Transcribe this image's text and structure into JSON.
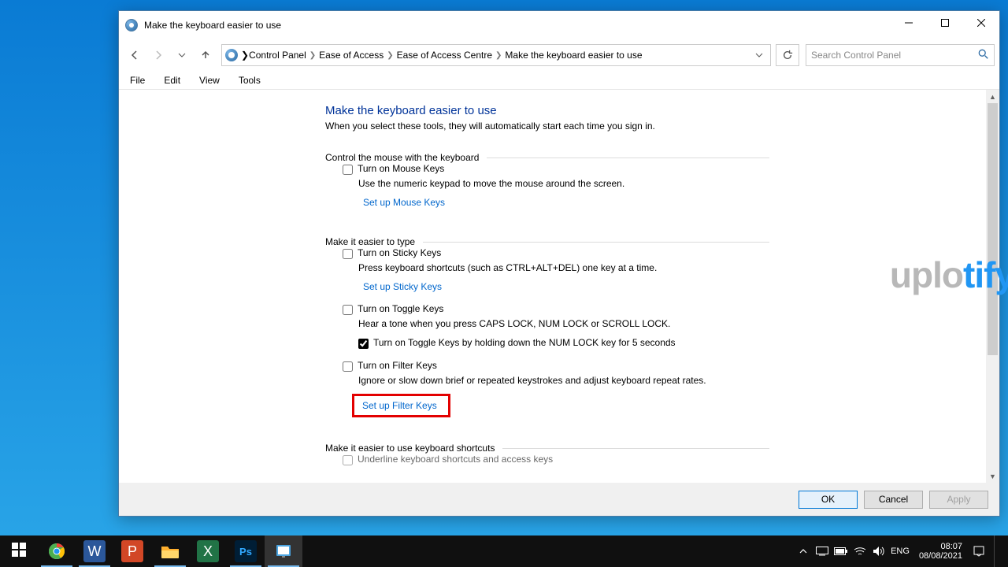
{
  "window": {
    "title": "Make the keyboard easier to use"
  },
  "breadcrumb": {
    "items": [
      "Control Panel",
      "Ease of Access",
      "Ease of Access Centre",
      "Make the keyboard easier to use"
    ]
  },
  "search": {
    "placeholder": "Search Control Panel"
  },
  "menu": {
    "file": "File",
    "edit": "Edit",
    "view": "View",
    "tools": "Tools"
  },
  "page": {
    "title": "Make the keyboard easier to use",
    "subtitle": "When you select these tools, they will automatically start each time you sign in."
  },
  "groups": {
    "mouse": {
      "label": "Control the mouse with the keyboard",
      "check": "Turn on Mouse Keys",
      "desc": "Use the numeric keypad to move the mouse around the screen.",
      "link": "Set up Mouse Keys"
    },
    "type": {
      "label": "Make it easier to type",
      "sticky": {
        "check": "Turn on Sticky Keys",
        "desc": "Press keyboard shortcuts (such as CTRL+ALT+DEL) one key at a time.",
        "link": "Set up Sticky Keys"
      },
      "toggle": {
        "check": "Turn on Toggle Keys",
        "desc": "Hear a tone when you press CAPS LOCK, NUM LOCK or SCROLL LOCK.",
        "hold": "Turn on Toggle Keys by holding down the NUM LOCK key for 5 seconds"
      },
      "filter": {
        "check": "Turn on Filter Keys",
        "desc": "Ignore or slow down brief or repeated keystrokes and adjust keyboard repeat rates.",
        "link": "Set up Filter Keys"
      }
    },
    "shortcuts": {
      "label": "Make it easier to use keyboard shortcuts",
      "underline": "Underline keyboard shortcuts and access keys"
    }
  },
  "footer": {
    "ok": "OK",
    "cancel": "Cancel",
    "apply": "Apply"
  },
  "watermark": {
    "part1": "uplo",
    "part2": "tify"
  },
  "tray": {
    "lang": "ENG",
    "time": "08:07",
    "date": "08/08/2021"
  }
}
